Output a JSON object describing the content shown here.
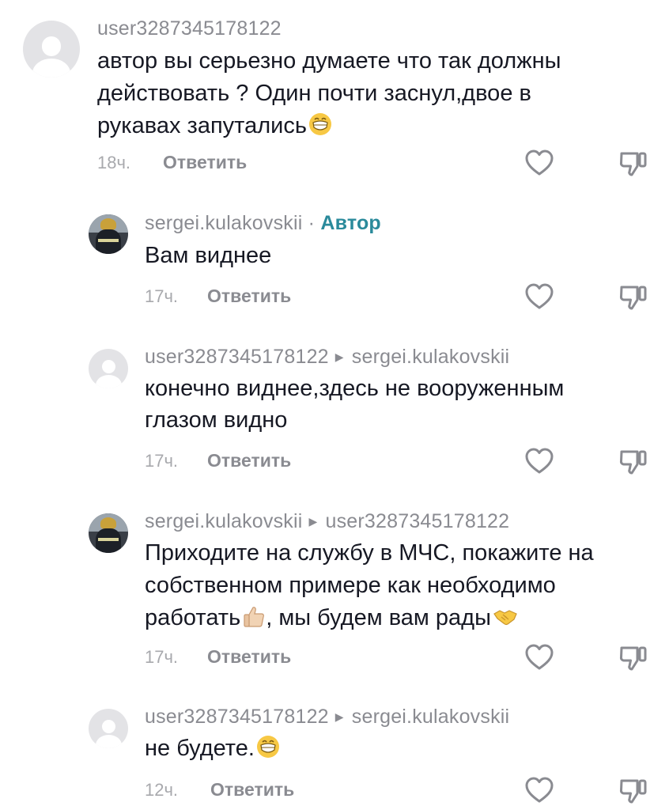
{
  "reply_label": "Ответить",
  "author_badge": "Автор",
  "comments": [
    {
      "user": "user3287345178122",
      "lines": [
        "автор вы серьезно думаете что так должны",
        "действовать ? Один почти заснул,двое в",
        "рукавах запутались"
      ],
      "time": "18ч."
    },
    {
      "user": "sergei.kulakovskii",
      "lines": [
        "Вам виднее"
      ],
      "time": "17ч."
    },
    {
      "user": "user3287345178122",
      "reply_to": "sergei.kulakovskii",
      "lines": [
        "конечно виднее,здесь не вооруженным",
        "глазом видно"
      ],
      "time": "17ч."
    },
    {
      "user": "sergei.kulakovskii",
      "reply_to": "user3287345178122",
      "lines": [
        "Приходите на службу в МЧС, покажите на",
        "собственном примере как необходимо",
        "работать",
        ", мы будем вам рады"
      ],
      "time": "17ч."
    },
    {
      "user": "user3287345178122",
      "reply_to": "sergei.kulakovskii",
      "lines": [
        "не будете."
      ],
      "time": "12ч."
    }
  ],
  "icons": {
    "like": "heart-outline-icon",
    "dislike": "thumbs-down-outline-icon",
    "emoji_grin": "grinning-face-emoji-icon",
    "emoji_thumbs": "thumbs-up-emoji-icon",
    "emoji_handshake": "handshake-emoji-icon",
    "reply_arrow": "reply-arrow-icon"
  },
  "colors": {
    "text": "#161823",
    "secondary": "#8a8b91",
    "author_badge": "#2a8a9b",
    "avatar_placeholder": "#e3e3e6"
  }
}
